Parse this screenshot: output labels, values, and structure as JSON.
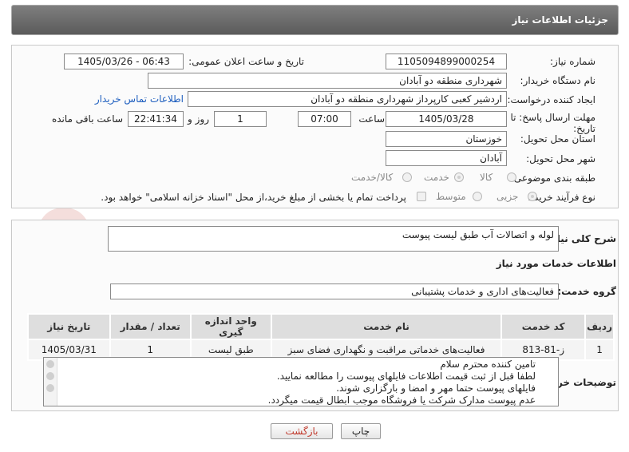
{
  "header": {
    "title": "جزئیات اطلاعات نیاز"
  },
  "form": {
    "need_number_label": "شماره نیاز:",
    "need_number": "1105094899000254",
    "announce_label": "تاریخ و ساعت اعلان عمومی:",
    "announce_value": "1405/03/26 - 06:43",
    "buyer_org_label": "نام دستگاه خریدار:",
    "buyer_org": "شهرداری منطقه دو آبادان",
    "creator_label": "ایجاد کننده درخواست:",
    "creator": "اردشیر کعبی کارپرداز شهرداری منطقه دو آبادان",
    "contact_link": "اطلاعات تماس خریدار",
    "deadline_label_1": "مهلت ارسال پاسخ: تا",
    "deadline_label_2": "تاریخ:",
    "deadline_date": "1405/03/28",
    "time_label": "ساعت",
    "deadline_time": "07:00",
    "days_value": "1",
    "days_label": "روز و",
    "remaining_time": "22:41:34",
    "remaining_label": "ساعت باقی مانده",
    "province_label": "استان محل تحویل:",
    "province": "خوزستان",
    "city_label": "شهر محل تحویل:",
    "city": "آبادان",
    "category_label": "طبقه بندی موضوعی:",
    "category_options": [
      "کالا",
      "خدمت",
      "کالا/خدمت"
    ],
    "process_label": "نوع فرآیند خرید :",
    "process_options": [
      "جزیی",
      "متوسط"
    ],
    "payment_note": "پرداخت تمام یا بخشی از مبلغ خرید،از محل \"اسناد خزانه اسلامی\" خواهد بود."
  },
  "description": {
    "label": "شرح کلی نیاز:",
    "value": "لوله و اتصالات آب طبق لیست پیوست"
  },
  "services": {
    "section_title": "اطلاعات خدمات مورد نیاز",
    "group_label": "گروه خدمت:",
    "group_value": "فعالیت‌های اداری و خدمات پشتیبانی"
  },
  "table": {
    "headers": [
      "ردیف",
      "کد خدمت",
      "نام خدمت",
      "واحد اندازه گیری",
      "تعداد / مقدار",
      "تاریخ نیاز"
    ],
    "rows": [
      [
        "1",
        "ز-81-813",
        "فعالیت‌های خدماتی مراقبت و نگهداری فضای سبز",
        "طبق لیست",
        "1",
        "1405/03/31"
      ]
    ]
  },
  "notes": {
    "label": "توضیحات خریدار:",
    "lines": [
      "تامین کننده محترم سلام",
      "لطفا قبل از ثبت قیمت اطلاعات فایلهای پیوست را مطالعه نمایید.",
      "فایلهای پیوست حتما مهر و امضا و بارگزاری شوند.",
      "عدم پیوست مدارک شرکت یا فروشگاه موجب ابطال قیمت میگردد."
    ]
  },
  "buttons": {
    "print": "چاپ",
    "back": "بازگشت"
  },
  "colors": {
    "header_bg": "#6b6b6b",
    "link": "#1f5fbf",
    "back_button_text": "#c0392b"
  }
}
